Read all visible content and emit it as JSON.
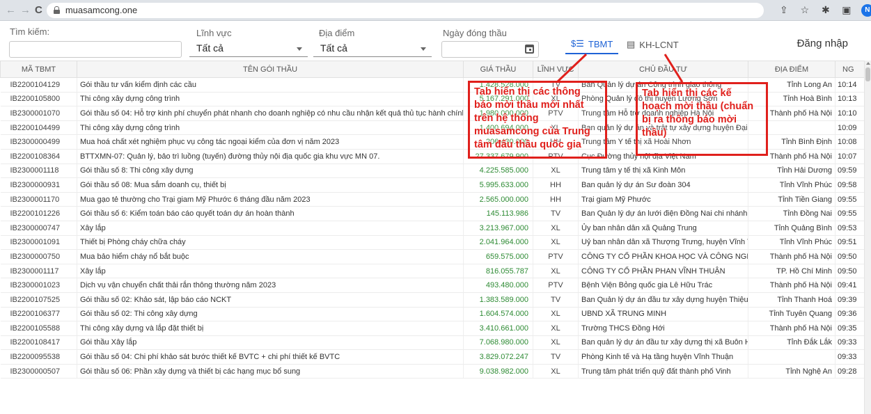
{
  "browser": {
    "url": "muasamcong.one",
    "back": "←",
    "forward": "→",
    "reload": "C",
    "profile_initial": "N"
  },
  "filters": {
    "search_label": "Tìm kiếm:",
    "search_value": "",
    "field_label": "Lĩnh vực",
    "field_value": "Tất cả",
    "location_label": "Địa điểm",
    "location_value": "Tất cả",
    "date_label": "Ngày đóng thầu",
    "date_value": ""
  },
  "tabs": [
    {
      "label": "TBMT",
      "icon": "notice-list-icon",
      "active": true
    },
    {
      "label": "KH-LCNT",
      "icon": "plan-document-icon",
      "active": false
    }
  ],
  "login_label": "Đăng nhập",
  "table": {
    "headers": [
      "MÃ TBMT",
      "TÊN GÓI THẦU",
      "GIÁ THẦU",
      "LĨNH VỰC",
      "CHỦ ĐẦU TƯ",
      "ĐỊA ĐIỂM",
      "NG"
    ],
    "rows": [
      {
        "code": "IB2200104129",
        "name": "Gói thầu tư vấn kiểm định các cầu",
        "price": "1.428.528.000",
        "field": "TV",
        "owner": "Ban Quản lý dự án Công trình giao thông",
        "location": "Tỉnh Long An",
        "time": "10:14"
      },
      {
        "code": "IB2200105800",
        "name": "Thi công xây dựng công trình",
        "price": "5.167.291.000",
        "field": "XL",
        "owner": "Phòng Quản lý đô thị huyện Lương Sơn",
        "location": "Tỉnh Hoà Bình",
        "time": "10:13"
      },
      {
        "code": "IB2300001070",
        "name": "Gói thầu số 04: Hỗ trợ kinh phí chuyển phát nhanh cho doanh nghiệp có nhu cầu nhận kết quả thủ tục hành chính về đăng ký doanh nghiệp",
        "price": "1.980.000.000",
        "field": "PTV",
        "owner": "Trung tâm Hỗ trợ doanh nghiệp Hà Nội",
        "location": "Thành phố Hà Nội",
        "time": "10:10"
      },
      {
        "code": "IB2200104499",
        "name": "Thi công xây dựng công trình",
        "price": "1.400.694.000",
        "field": "XL",
        "owner": "Ban quản lý dự án và trật tự xây dựng huyện Đại Lộc",
        "location": "",
        "time": "10:09"
      },
      {
        "code": "IB2300000499",
        "name": "Mua hoá chất xét nghiệm phục vụ công tác ngoại kiểm của đơn vị năm 2023",
        "price": "206.430.000",
        "field": "HH",
        "owner": "Trung tâm Y tế thị xã Hoài Nhơn",
        "location": "Tỉnh Bình Định",
        "time": "10:08"
      },
      {
        "code": "IB2200108364",
        "name": "BTTXMN-07: Quản lý, bảo trì luồng (tuyến) đường thủy nội địa quốc gia khu vực MN 07.",
        "price": "27.337.679.900",
        "field": "PTV",
        "owner": "Cục Đường thủy nội địa Việt Nam",
        "location": "Thành phố Hà Nội",
        "time": "10:07"
      },
      {
        "code": "IB2300001118",
        "name": "Gói thầu số 8: Thi công xây dựng",
        "price": "4.225.585.000",
        "field": "XL",
        "owner": "Trung tâm y tế thị xã Kinh Môn",
        "location": "Tỉnh Hải Dương",
        "time": "09:59"
      },
      {
        "code": "IB2300000931",
        "name": "Gói thầu số 08: Mua sắm doanh cụ, thiết bị",
        "price": "5.995.633.000",
        "field": "HH",
        "owner": "Ban quản lý dự án Sư đoàn 304",
        "location": "Tỉnh Vĩnh Phúc",
        "time": "09:58"
      },
      {
        "code": "IB2300001170",
        "name": "Mua gạo tẻ thường cho Trại giam Mỹ Phước 6 tháng đầu năm 2023",
        "price": "2.565.000.000",
        "field": "HH",
        "owner": "Trại giam Mỹ Phước",
        "location": "Tỉnh Tiền Giang",
        "time": "09:55"
      },
      {
        "code": "IB2200101226",
        "name": "Gói thầu số 6: Kiểm toán báo cáo quyết toán dự án hoàn thành",
        "price": "145.113.986",
        "field": "TV",
        "owner": "Ban Quản lý dự án lưới điện Đồng Nai chi nhánh Công",
        "location": "Tỉnh Đồng Nai",
        "time": "09:55"
      },
      {
        "code": "IB2300000747",
        "name": "Xây lắp",
        "price": "3.213.967.000",
        "field": "XL",
        "owner": "Ủy ban nhân dân xã Quảng Trung",
        "location": "Tỉnh Quảng Bình",
        "time": "09:53"
      },
      {
        "code": "IB2300001091",
        "name": "Thiết bị Phòng cháy chữa cháy",
        "price": "2.041.964.000",
        "field": "XL",
        "owner": "Uỷ ban nhân dân xã Thượng Trưng, huyện Vĩnh Tường",
        "location": "Tỉnh Vĩnh Phúc",
        "time": "09:51"
      },
      {
        "code": "IB2300000750",
        "name": "Mua bảo hiểm cháy nổ bắt buộc",
        "price": "659.575.000",
        "field": "PTV",
        "owner": "CÔNG TY CỔ PHẦN KHOA HỌC VÀ CÔNG NGHỆ XÃ",
        "location": "Thành phố Hà Nội",
        "time": "09:50"
      },
      {
        "code": "IB2300001117",
        "name": "Xây lắp",
        "price": "816.055.787",
        "field": "XL",
        "owner": "CÔNG TY CỔ PHẦN PHAN VĨNH THUẬN",
        "location": "TP. Hồ Chí Minh",
        "time": "09:50"
      },
      {
        "code": "IB2300001023",
        "name": "Dịch vụ vận chuyển chất thải rắn thông thường năm 2023",
        "price": "493.480.000",
        "field": "PTV",
        "owner": "Bệnh Viện Bỏng quốc gia Lê Hữu Trác",
        "location": "Thành phố Hà Nội",
        "time": "09:41"
      },
      {
        "code": "IB2200107525",
        "name": "Gói thầu số 02: Khảo sát, lập báo cáo NCKT",
        "price": "1.383.589.000",
        "field": "TV",
        "owner": "Ban Quản lý dự án đầu tư xây dựng huyện Thiệu Hóa",
        "location": "Tỉnh Thanh Hoá",
        "time": "09:39"
      },
      {
        "code": "IB2200106377",
        "name": "Gói thầu số 02: Thi công xây dựng",
        "price": "1.604.574.000",
        "field": "XL",
        "owner": "UBND XÃ TRUNG MINH",
        "location": "Tỉnh Tuyên Quang",
        "time": "09:36"
      },
      {
        "code": "IB2200105588",
        "name": "Thi công xây dựng và lắp đặt thiết bị",
        "price": "3.410.661.000",
        "field": "XL",
        "owner": "Trường THCS Đồng Hới",
        "location": "Thành phố Hà Nội",
        "time": "09:35"
      },
      {
        "code": "IB2200108417",
        "name": "Gói thầu Xây lắp",
        "price": "7.068.980.000",
        "field": "XL",
        "owner": "Ban quản lý dự án đầu tư xây dựng thị xã Buôn Hồ",
        "location": "Tỉnh Đắk Lắk",
        "time": "09:33"
      },
      {
        "code": "IB2200095538",
        "name": "Gói thầu số 04: Chi phí khảo sát bước thiết kế BVTC + chi phí thiết kế BVTC",
        "price": "3.829.072.247",
        "field": "TV",
        "owner": "Phòng Kinh tế và Hạ tầng huyện Vĩnh Thuận",
        "location": "",
        "time": "09:33"
      },
      {
        "code": "IB2300000507",
        "name": "Gói thầu số 06: Phần xây dựng và thiết bị các hạng mục bổ sung",
        "price": "9.038.982.000",
        "field": "XL",
        "owner": "Trung tâm phát triển quỹ đất thành phố Vinh",
        "location": "Tỉnh Nghệ An",
        "time": "09:28"
      }
    ]
  },
  "annotations": {
    "tbmt_note": "Tab hiển thị các thông báo mời thầu mới nhất trên hệ thống muasamcong của Trung tâm đấu thầu quốc gia",
    "khlcnt_note": "Tab hiển thị các kế hoạch mời thầu (chuẩn bị ra thông báo mời thầu)",
    "color": "#e0201c"
  }
}
